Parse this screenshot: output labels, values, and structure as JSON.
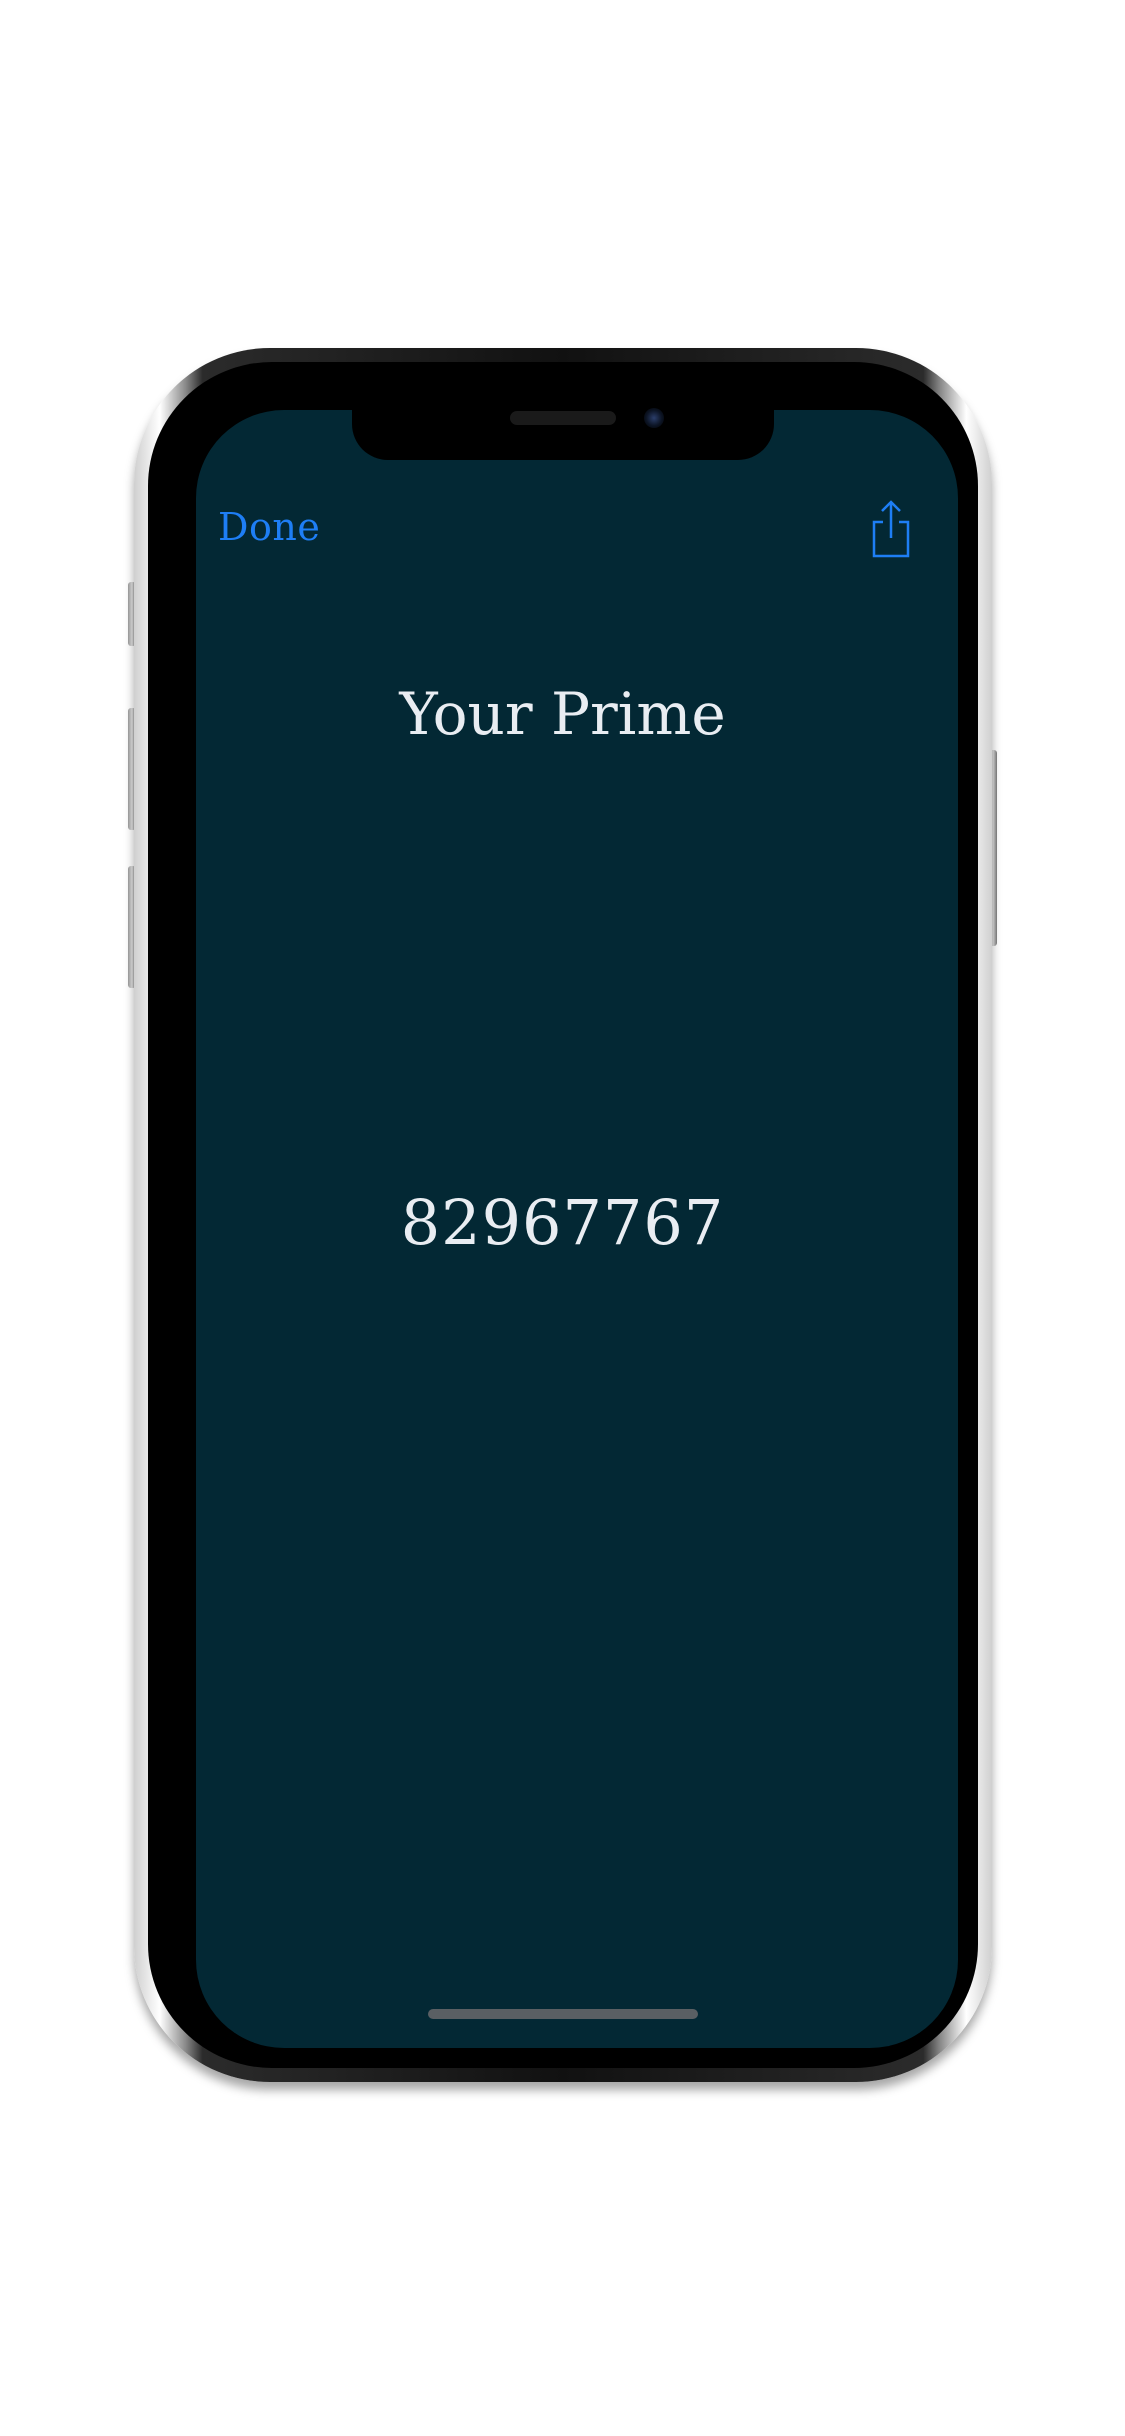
{
  "app": {
    "done_label": "Done",
    "share_icon": "share-icon",
    "title": "Your Prime",
    "prime_value": "82967767"
  },
  "colors": {
    "background": "#032834",
    "accent": "#1e7ef5",
    "text": "#e9edf2"
  }
}
